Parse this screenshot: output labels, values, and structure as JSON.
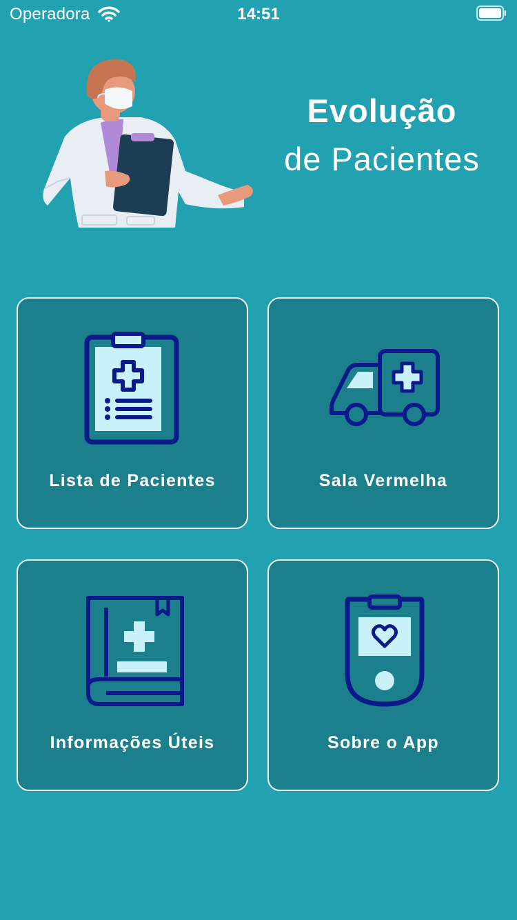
{
  "status_bar": {
    "carrier": "Operadora",
    "time": "14:51",
    "icons": [
      "wifi-icon",
      "battery-icon"
    ]
  },
  "header": {
    "title_line1": "Evolução",
    "title_line2": "de Pacientes",
    "illustration": "doctor-with-clipboard"
  },
  "menu": {
    "items": [
      {
        "label": "Lista de Pacientes",
        "icon": "clipboard-medical-icon"
      },
      {
        "label": "Sala Vermelha",
        "icon": "ambulance-icon"
      },
      {
        "label": "Informações Úteis",
        "icon": "medical-book-icon"
      },
      {
        "label": "Sobre o App",
        "icon": "heart-monitor-device-icon"
      }
    ]
  },
  "colors": {
    "background": "#22a1b0",
    "card": "#1c7f8c",
    "card_border": "#f2fbfc",
    "icon_stroke": "#0a1a8a",
    "icon_fill": "#c9f1f8"
  }
}
